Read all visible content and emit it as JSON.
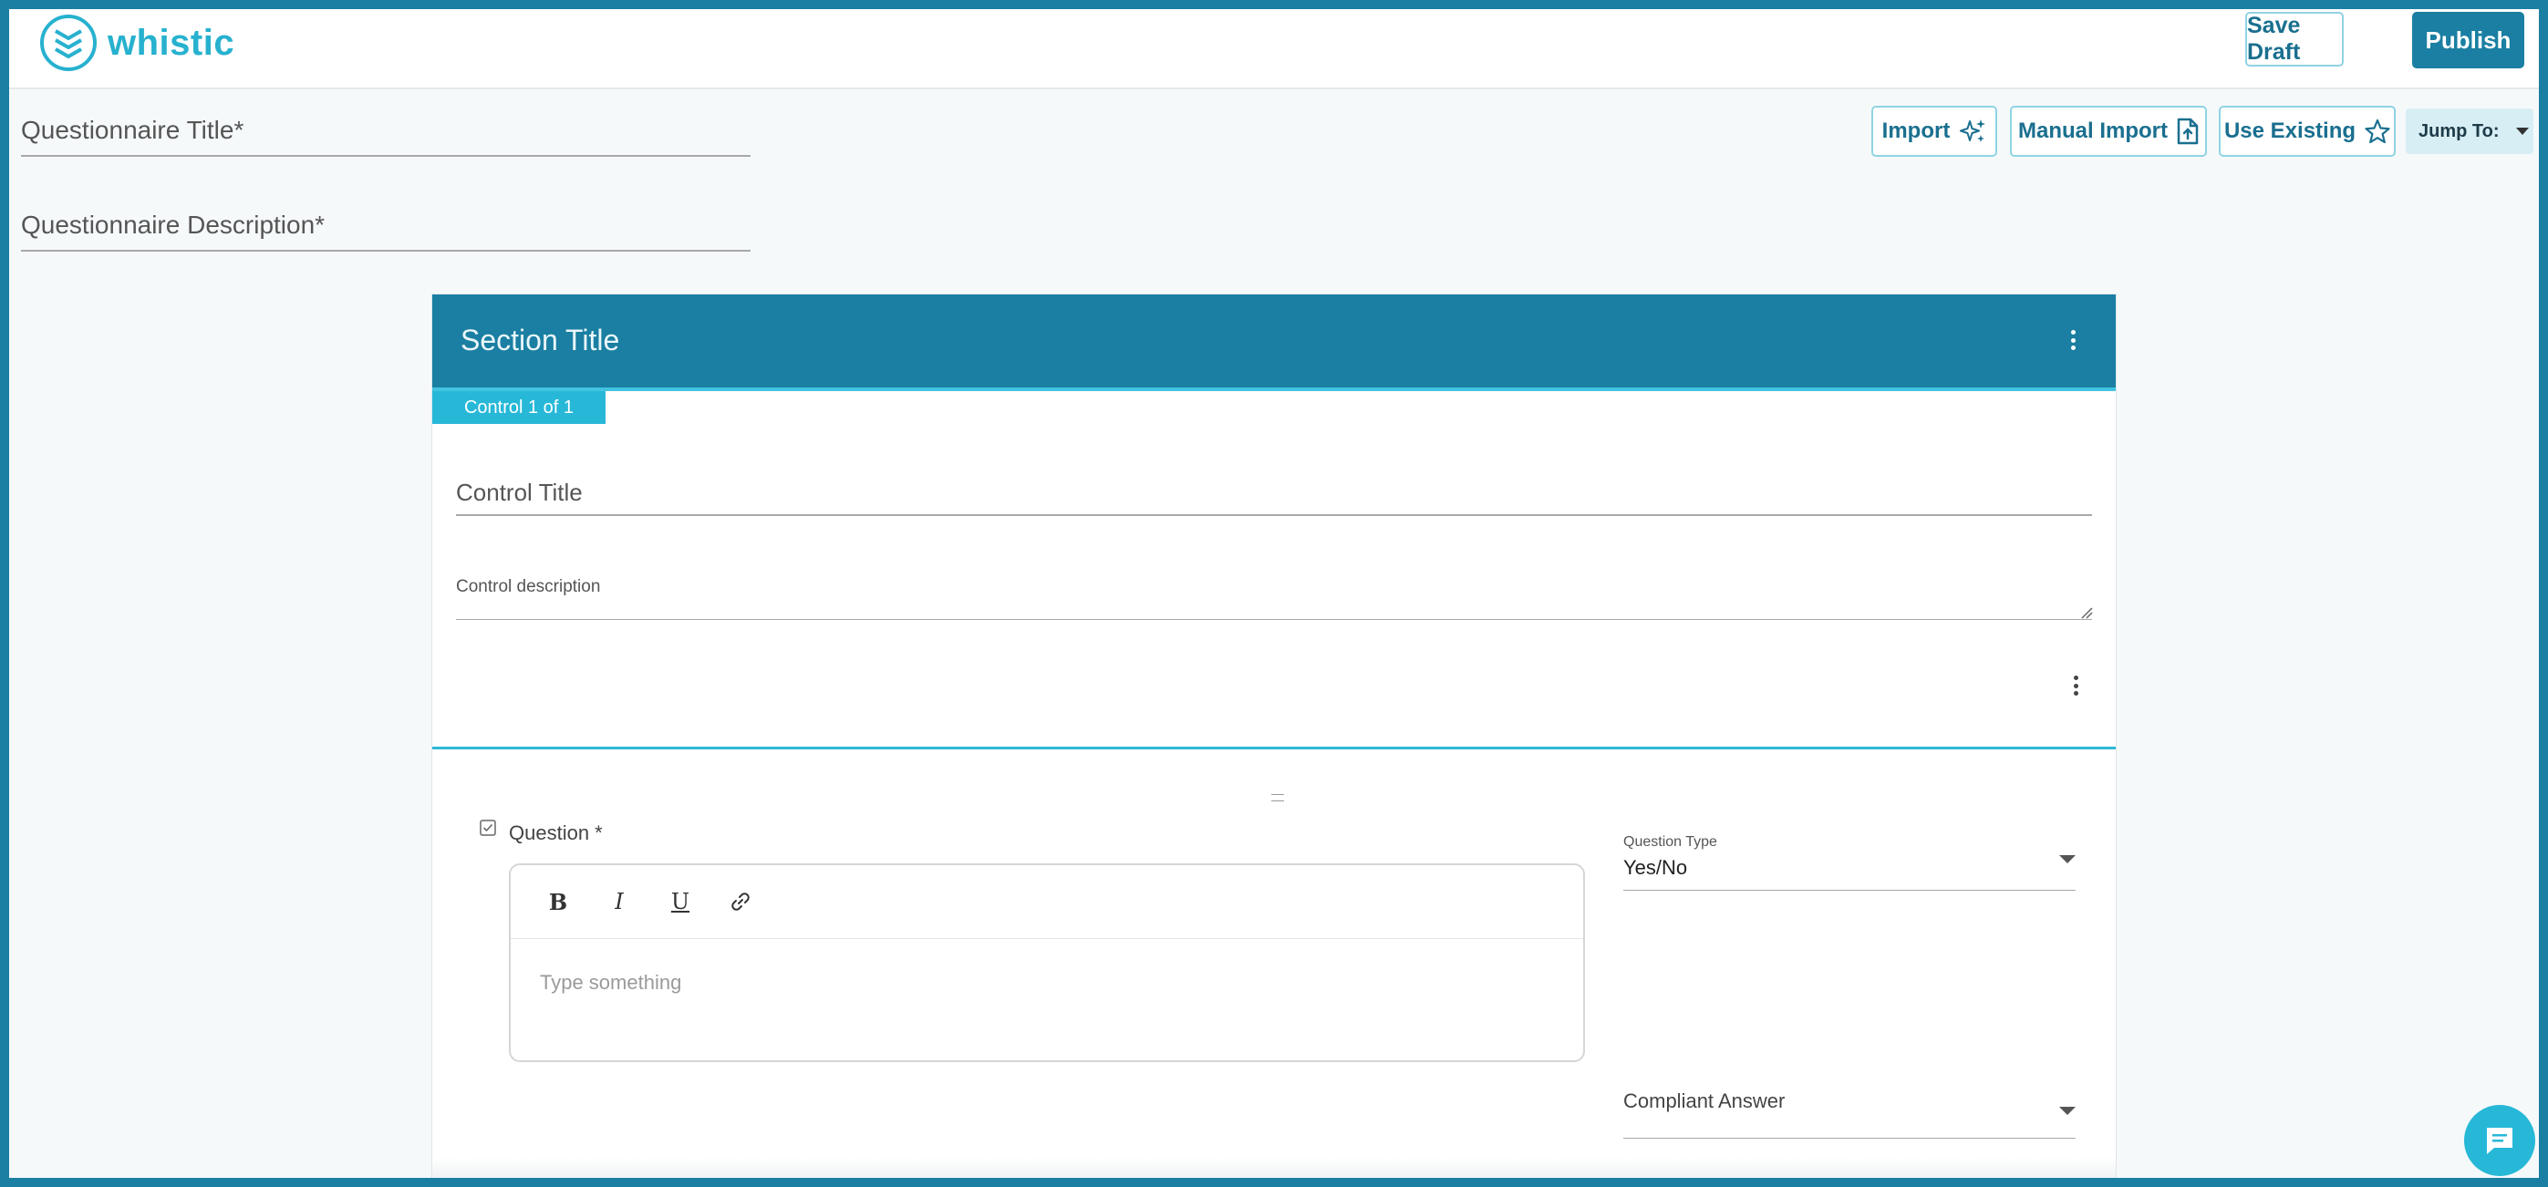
{
  "app": {
    "brand": "whistic",
    "colors": {
      "primary": "#1a7fa2",
      "accent": "#27b8d8",
      "background": "#f5f9fa"
    }
  },
  "header": {
    "save_draft_label": "Save Draft",
    "publish_label": "Publish"
  },
  "form": {
    "title_placeholder": "Questionnaire Title*",
    "description_placeholder": "Questionnaire Description*"
  },
  "actions": {
    "import_label": "Import",
    "import_icon": "sparkle-icon",
    "manual_import_label": "Manual Import",
    "manual_import_icon": "file-upload-icon",
    "use_existing_label": "Use Existing",
    "use_existing_icon": "star-icon",
    "jump_to_label": "Jump To:"
  },
  "section": {
    "title": "Section Title",
    "control_badge": "Control 1 of 1",
    "control_title_placeholder": "Control Title",
    "control_description_placeholder": "Control description"
  },
  "question": {
    "label": "Question *",
    "editor_placeholder": "Type something",
    "toolbar": {
      "bold": "B",
      "italic": "I",
      "underline": "U",
      "link_icon": "link-icon"
    },
    "type_label": "Question Type",
    "type_value": "Yes/No",
    "compliant_answer_label": "Compliant Answer"
  }
}
